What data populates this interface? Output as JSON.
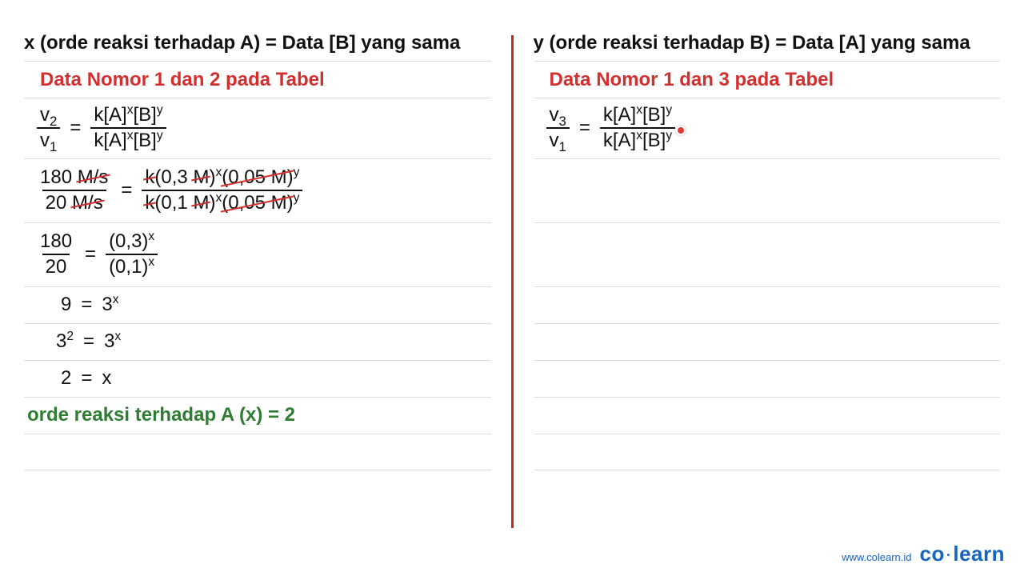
{
  "left": {
    "heading_pre": "x (orde reaksi terhadap A) = Data ",
    "heading_br_open": "[",
    "heading_var": "B",
    "heading_br_close": "]",
    "heading_post": " yang sama",
    "subhead": "Data Nomor 1 dan 2 pada Tabel",
    "f1": {
      "lhs_num_v": "v",
      "lhs_num_sub": "2",
      "lhs_den_v": "v",
      "lhs_den_sub": "1",
      "rhs_num": "k[A]",
      "rhs_num_x": "x",
      "rhs_num_b": "[B]",
      "rhs_num_y": "y",
      "rhs_den": "k[A]",
      "rhs_den_x": "x",
      "rhs_den_b": "[B]",
      "rhs_den_y": "y"
    },
    "f2": {
      "lhs_num_a": "180 ",
      "lhs_num_strike": "M/s",
      "lhs_den_a": "20 ",
      "lhs_den_strike": "M/s",
      "rhs_num_k": "k",
      "rhs_num_open": "(0,3 ",
      "rhs_num_m": "M",
      "rhs_num_close": ")",
      "rhs_num_x": "x",
      "rhs_num_y_open": "(0,05 M)",
      "rhs_num_y": "y",
      "rhs_den_k": "k",
      "rhs_den_open": "(0,1 ",
      "rhs_den_m": "M",
      "rhs_den_close": ")",
      "rhs_den_x": "x",
      "rhs_den_y_open": "(0,05 M)",
      "rhs_den_y": "y"
    },
    "f3": {
      "lhs_num": "180",
      "lhs_den": "20",
      "rhs_num_a": "(0,3)",
      "rhs_num_x": "x",
      "rhs_den_a": "(0,1)",
      "rhs_den_x": "x"
    },
    "f4_l": "9",
    "f4_r_base": "3",
    "f4_r_x": "x",
    "f5_l_base": "3",
    "f5_l_sup": "2",
    "f5_r_base": "3",
    "f5_r_x": "x",
    "f6_l": "2",
    "f6_r": "x",
    "result": "orde reaksi terhadap A (x) = 2",
    "eq": "="
  },
  "right": {
    "heading_pre": "y (orde reaksi terhadap B) = Data ",
    "heading_br_open": "[",
    "heading_var": "A",
    "heading_br_close": "]",
    "heading_post": " yang sama",
    "subhead": "Data Nomor 1 dan 3 pada Tabel",
    "f1": {
      "lhs_num_v": "v",
      "lhs_num_sub": "3",
      "lhs_den_v": "v",
      "lhs_den_sub": "1",
      "rhs_num": "k[A]",
      "rhs_num_x": "x",
      "rhs_num_b": "[B]",
      "rhs_num_y": "y",
      "rhs_den": "k[A]",
      "rhs_den_x": "x",
      "rhs_den_b": "[B]",
      "rhs_den_y": "y"
    },
    "eq": "="
  },
  "footer": {
    "url": "www.colearn.id",
    "brand_a": "co",
    "brand_b": "learn"
  }
}
